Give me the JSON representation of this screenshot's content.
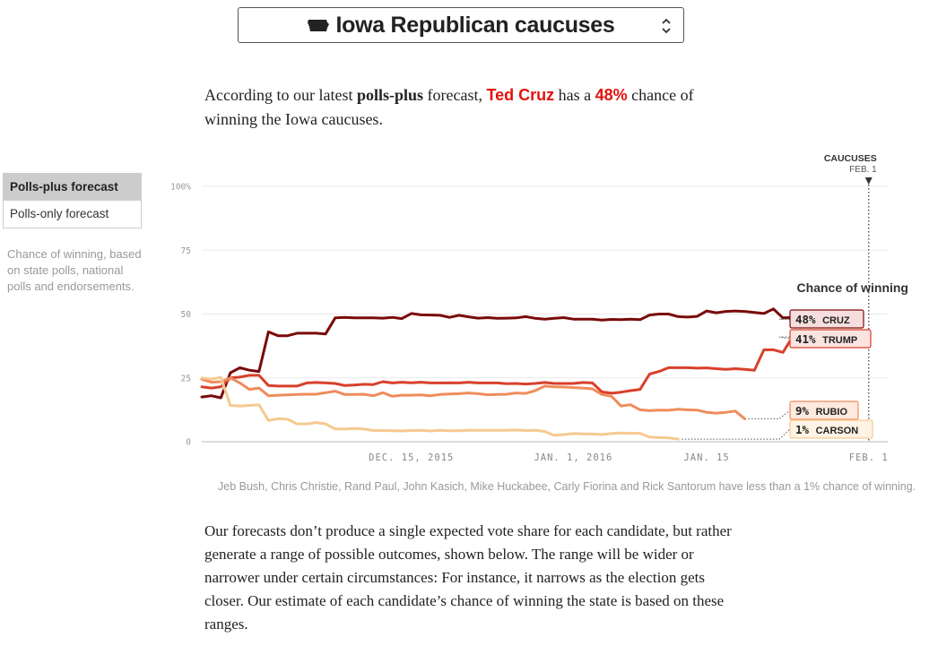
{
  "selector": {
    "state": "Iowa Republican caucuses"
  },
  "intro": {
    "part1": "According to our latest ",
    "forecast_name": "polls-plus",
    "part2": " forecast, ",
    "leader": "Ted Cruz",
    "part3": " has a ",
    "leader_pct": "48%",
    "part4": " chance of winning the Iowa caucuses."
  },
  "toggle": {
    "options": [
      "Polls-plus forecast",
      "Polls-only forecast"
    ],
    "selected": "Polls-plus forecast"
  },
  "description": "Chance of winning, based on state polls, national polls and endorsements.",
  "chart_data": {
    "type": "line",
    "title": "",
    "ylabel": "",
    "ylim": [
      0,
      100
    ],
    "y_ticks": [
      "100%",
      "75",
      "50",
      "25",
      "0"
    ],
    "x_ticks": [
      "DEC. 15, 2015",
      "JAN. 1, 2016",
      "JAN. 15",
      "FEB. 1"
    ],
    "event_marker": {
      "label": "CAUCUSES",
      "date_label": "FEB. 1"
    },
    "legend_title": "Chance of winning",
    "colors": {
      "Cruz": "#7a0a0a",
      "Trump": "#d8402b",
      "Rubio": "#ef8c5c",
      "Carson": "#f7c990"
    },
    "series": [
      {
        "name": "Cruz",
        "label": "48% CRUZ",
        "color": "#7a0a0a",
        "values": [
          [
            "2015-11-23",
            17.5
          ],
          [
            "2015-11-24",
            18
          ],
          [
            "2015-11-25",
            17.2
          ],
          [
            "2015-11-26",
            27
          ],
          [
            "2015-11-27",
            29
          ],
          [
            "2015-11-28",
            28
          ],
          [
            "2015-11-29",
            27.5
          ],
          [
            "2015-11-30",
            43
          ],
          [
            "2015-12-01",
            41.5
          ],
          [
            "2015-12-02",
            41.5
          ],
          [
            "2015-12-03",
            42.5
          ],
          [
            "2015-12-04",
            42.5
          ],
          [
            "2015-12-05",
            42.5
          ],
          [
            "2015-12-06",
            42.2
          ],
          [
            "2015-12-07",
            48.5
          ],
          [
            "2015-12-08",
            48.7
          ],
          [
            "2015-12-09",
            48.5
          ],
          [
            "2015-12-10",
            48.5
          ],
          [
            "2015-12-11",
            48.5
          ],
          [
            "2015-12-12",
            48.4
          ],
          [
            "2015-12-13",
            48.7
          ],
          [
            "2015-12-14",
            48.2
          ],
          [
            "2015-12-15",
            50.2
          ],
          [
            "2015-12-16",
            49.7
          ],
          [
            "2015-12-17",
            49.6
          ],
          [
            "2015-12-18",
            49.5
          ],
          [
            "2015-12-19",
            48.7
          ],
          [
            "2015-12-20",
            49.5
          ],
          [
            "2015-12-21",
            48.9
          ],
          [
            "2015-12-22",
            48.4
          ],
          [
            "2015-12-23",
            48.6
          ],
          [
            "2015-12-24",
            48.3
          ],
          [
            "2015-12-25",
            48.4
          ],
          [
            "2015-12-26",
            48.5
          ],
          [
            "2015-12-27",
            49
          ],
          [
            "2015-12-28",
            48.3
          ],
          [
            "2015-12-29",
            48
          ],
          [
            "2015-12-30",
            48.3
          ],
          [
            "2015-12-31",
            48.6
          ],
          [
            "2016-01-01",
            48
          ],
          [
            "2016-01-02",
            48
          ],
          [
            "2016-01-03",
            48
          ],
          [
            "2016-01-04",
            47.6
          ],
          [
            "2016-01-05",
            47.9
          ],
          [
            "2016-01-06",
            47.8
          ],
          [
            "2016-01-07",
            48
          ],
          [
            "2016-01-08",
            47.8
          ],
          [
            "2016-01-09",
            49.6
          ],
          [
            "2016-01-10",
            50
          ],
          [
            "2016-01-11",
            50
          ],
          [
            "2016-01-12",
            49
          ],
          [
            "2016-01-13",
            48.8
          ],
          [
            "2016-01-14",
            49.1
          ],
          [
            "2016-01-15",
            51.2
          ],
          [
            "2016-01-16",
            50.5
          ],
          [
            "2016-01-17",
            51
          ],
          [
            "2016-01-18",
            51.2
          ],
          [
            "2016-01-19",
            51
          ],
          [
            "2016-01-20",
            50.6
          ],
          [
            "2016-01-21",
            50.2
          ],
          [
            "2016-01-22",
            52
          ],
          [
            "2016-01-23",
            48.5
          ],
          [
            "2016-01-24",
            48.7
          ],
          [
            "2016-01-25",
            49
          ],
          [
            "2016-01-26",
            48
          ]
        ]
      },
      {
        "name": "Trump",
        "label": "41% TRUMP",
        "color": "#d8402b",
        "values": [
          [
            "2015-11-23",
            21.5
          ],
          [
            "2015-11-24",
            21
          ],
          [
            "2015-11-25",
            21.5
          ],
          [
            "2015-11-26",
            25
          ],
          [
            "2015-11-27",
            25.3
          ],
          [
            "2015-11-28",
            26
          ],
          [
            "2015-11-29",
            26
          ],
          [
            "2015-11-30",
            22
          ],
          [
            "2015-12-01",
            21.8
          ],
          [
            "2015-12-02",
            21.8
          ],
          [
            "2015-12-03",
            21.8
          ],
          [
            "2015-12-04",
            23
          ],
          [
            "2015-12-05",
            23.2
          ],
          [
            "2015-12-06",
            23
          ],
          [
            "2015-12-07",
            22.8
          ],
          [
            "2015-12-08",
            22
          ],
          [
            "2015-12-09",
            22.2
          ],
          [
            "2015-12-10",
            22.5
          ],
          [
            "2015-12-11",
            22.4
          ],
          [
            "2015-12-12",
            23.5
          ],
          [
            "2015-12-13",
            23
          ],
          [
            "2015-12-14",
            23.3
          ],
          [
            "2015-12-15",
            23.1
          ],
          [
            "2015-12-16",
            23.3
          ],
          [
            "2015-12-17",
            23
          ],
          [
            "2015-12-18",
            23
          ],
          [
            "2015-12-19",
            23.1
          ],
          [
            "2015-12-20",
            23
          ],
          [
            "2015-12-21",
            23.3
          ],
          [
            "2015-12-22",
            23
          ],
          [
            "2015-12-23",
            23
          ],
          [
            "2015-12-24",
            23
          ],
          [
            "2015-12-25",
            22.7
          ],
          [
            "2015-12-26",
            22.8
          ],
          [
            "2015-12-27",
            22.6
          ],
          [
            "2015-12-28",
            22.8
          ],
          [
            "2015-12-29",
            23.2
          ],
          [
            "2015-12-30",
            22.8
          ],
          [
            "2015-12-31",
            22.8
          ],
          [
            "2016-01-01",
            22.8
          ],
          [
            "2016-01-02",
            23.2
          ],
          [
            "2016-01-03",
            23
          ],
          [
            "2016-01-04",
            19.5
          ],
          [
            "2016-01-05",
            19
          ],
          [
            "2016-01-06",
            19.4
          ],
          [
            "2016-01-07",
            20
          ],
          [
            "2016-01-08",
            20.5
          ],
          [
            "2016-01-09",
            26.5
          ],
          [
            "2016-01-10",
            27.5
          ],
          [
            "2016-01-11",
            29
          ],
          [
            "2016-01-12",
            29
          ],
          [
            "2016-01-13",
            29
          ],
          [
            "2016-01-14",
            28.8
          ],
          [
            "2016-01-15",
            28.9
          ],
          [
            "2016-01-16",
            28.6
          ],
          [
            "2016-01-17",
            28.3
          ],
          [
            "2016-01-18",
            28.6
          ],
          [
            "2016-01-19",
            28.3
          ],
          [
            "2016-01-20",
            28
          ],
          [
            "2016-01-21",
            36
          ],
          [
            "2016-01-22",
            36
          ],
          [
            "2016-01-23",
            35
          ],
          [
            "2016-01-24",
            41
          ]
        ]
      },
      {
        "name": "Rubio",
        "label": "9% RUBIO",
        "color": "#ef8c5c",
        "values": [
          [
            "2015-11-23",
            24.5
          ],
          [
            "2015-11-24",
            23.3
          ],
          [
            "2015-11-25",
            23.5
          ],
          [
            "2015-11-26",
            25
          ],
          [
            "2015-11-27",
            23
          ],
          [
            "2015-11-28",
            20.5
          ],
          [
            "2015-11-29",
            21
          ],
          [
            "2015-11-30",
            18
          ],
          [
            "2015-12-01",
            18.2
          ],
          [
            "2015-12-02",
            18.3
          ],
          [
            "2015-12-03",
            18.5
          ],
          [
            "2015-12-04",
            18.6
          ],
          [
            "2015-12-05",
            18.6
          ],
          [
            "2015-12-06",
            19.2
          ],
          [
            "2015-12-07",
            19.8
          ],
          [
            "2015-12-08",
            18.5
          ],
          [
            "2015-12-09",
            18.5
          ],
          [
            "2015-12-10",
            18.6
          ],
          [
            "2015-12-11",
            18
          ],
          [
            "2015-12-12",
            19.2
          ],
          [
            "2015-12-13",
            17.8
          ],
          [
            "2015-12-14",
            18.2
          ],
          [
            "2015-12-15",
            18.2
          ],
          [
            "2015-12-16",
            18.3
          ],
          [
            "2015-12-17",
            18
          ],
          [
            "2015-12-18",
            18.5
          ],
          [
            "2015-12-19",
            18.7
          ],
          [
            "2015-12-20",
            18.8
          ],
          [
            "2015-12-21",
            19.1
          ],
          [
            "2015-12-22",
            18.8
          ],
          [
            "2015-12-23",
            18.4
          ],
          [
            "2015-12-24",
            18.5
          ],
          [
            "2015-12-25",
            18.6
          ],
          [
            "2015-12-26",
            19.1
          ],
          [
            "2015-12-27",
            18.9
          ],
          [
            "2015-12-28",
            20
          ],
          [
            "2015-12-29",
            21.8
          ],
          [
            "2015-12-30",
            21.5
          ],
          [
            "2015-12-31",
            21.4
          ],
          [
            "2016-01-01",
            21.2
          ],
          [
            "2016-01-02",
            21
          ],
          [
            "2016-01-03",
            20.7
          ],
          [
            "2016-01-04",
            18.5
          ],
          [
            "2016-01-05",
            17.8
          ],
          [
            "2016-01-06",
            14
          ],
          [
            "2016-01-07",
            14.5
          ],
          [
            "2016-01-08",
            12.5
          ],
          [
            "2016-01-09",
            12.2
          ],
          [
            "2016-01-10",
            12.4
          ],
          [
            "2016-01-11",
            12.3
          ],
          [
            "2016-01-12",
            12.7
          ],
          [
            "2016-01-13",
            12.5
          ],
          [
            "2016-01-14",
            12.4
          ],
          [
            "2016-01-15",
            11.5
          ],
          [
            "2016-01-16",
            11.2
          ],
          [
            "2016-01-17",
            11.5
          ],
          [
            "2016-01-18",
            12
          ],
          [
            "2016-01-19",
            9
          ]
        ]
      },
      {
        "name": "Carson",
        "label": "1% CARSON",
        "color": "#f7c990",
        "values": [
          [
            "2015-11-23",
            25
          ],
          [
            "2015-11-24",
            24.5
          ],
          [
            "2015-11-25",
            25.2
          ],
          [
            "2015-11-26",
            14.2
          ],
          [
            "2015-11-27",
            14
          ],
          [
            "2015-11-28",
            14.2
          ],
          [
            "2015-11-29",
            14.5
          ],
          [
            "2015-11-30",
            8.3
          ],
          [
            "2015-12-01",
            9
          ],
          [
            "2015-12-02",
            8.8
          ],
          [
            "2015-12-03",
            7
          ],
          [
            "2015-12-04",
            7
          ],
          [
            "2015-12-05",
            7.5
          ],
          [
            "2015-12-06",
            7
          ],
          [
            "2015-12-07",
            5
          ],
          [
            "2015-12-08",
            5
          ],
          [
            "2015-12-09",
            5.2
          ],
          [
            "2015-12-10",
            5
          ],
          [
            "2015-12-11",
            4.4
          ],
          [
            "2015-12-12",
            4.4
          ],
          [
            "2015-12-13",
            4.3
          ],
          [
            "2015-12-14",
            4.2
          ],
          [
            "2015-12-15",
            4.4
          ],
          [
            "2015-12-16",
            4.5
          ],
          [
            "2015-12-17",
            4.2
          ],
          [
            "2015-12-18",
            4.5
          ],
          [
            "2015-12-19",
            4.3
          ],
          [
            "2015-12-20",
            4.3
          ],
          [
            "2015-12-21",
            4.5
          ],
          [
            "2015-12-22",
            4.5
          ],
          [
            "2015-12-23",
            4.5
          ],
          [
            "2015-12-24",
            4.5
          ],
          [
            "2015-12-25",
            4.5
          ],
          [
            "2015-12-26",
            4.6
          ],
          [
            "2015-12-27",
            4.4
          ],
          [
            "2015-12-28",
            4.5
          ],
          [
            "2015-12-29",
            4
          ],
          [
            "2015-12-30",
            2.5
          ],
          [
            "2015-12-31",
            2.8
          ],
          [
            "2016-01-01",
            3.2
          ],
          [
            "2016-01-02",
            3.1
          ],
          [
            "2016-01-03",
            3
          ],
          [
            "2016-01-04",
            2.8
          ],
          [
            "2016-01-05",
            3.2
          ],
          [
            "2016-01-06",
            3.4
          ],
          [
            "2016-01-07",
            3.3
          ],
          [
            "2016-01-08",
            3.3
          ],
          [
            "2016-01-09",
            1.8
          ],
          [
            "2016-01-10",
            1.6
          ],
          [
            "2016-01-11",
            1.5
          ],
          [
            "2016-01-12",
            1
          ]
        ]
      }
    ]
  },
  "footnote": "Jeb Bush, Chris Christie, Rand Paul, John Kasich, Mike Huckabee, Carly Fiorina and Rick Santorum have less than a 1% chance of winning.",
  "body_text": "Our forecasts don’t produce a single expected vote share for each candidate, but rather generate a range of possible outcomes, shown below. The range will be wider or narrower under certain circumstances: For instance, it narrows as the election gets closer. Our estimate of each candidate’s chance of winning the state is based on these ranges."
}
